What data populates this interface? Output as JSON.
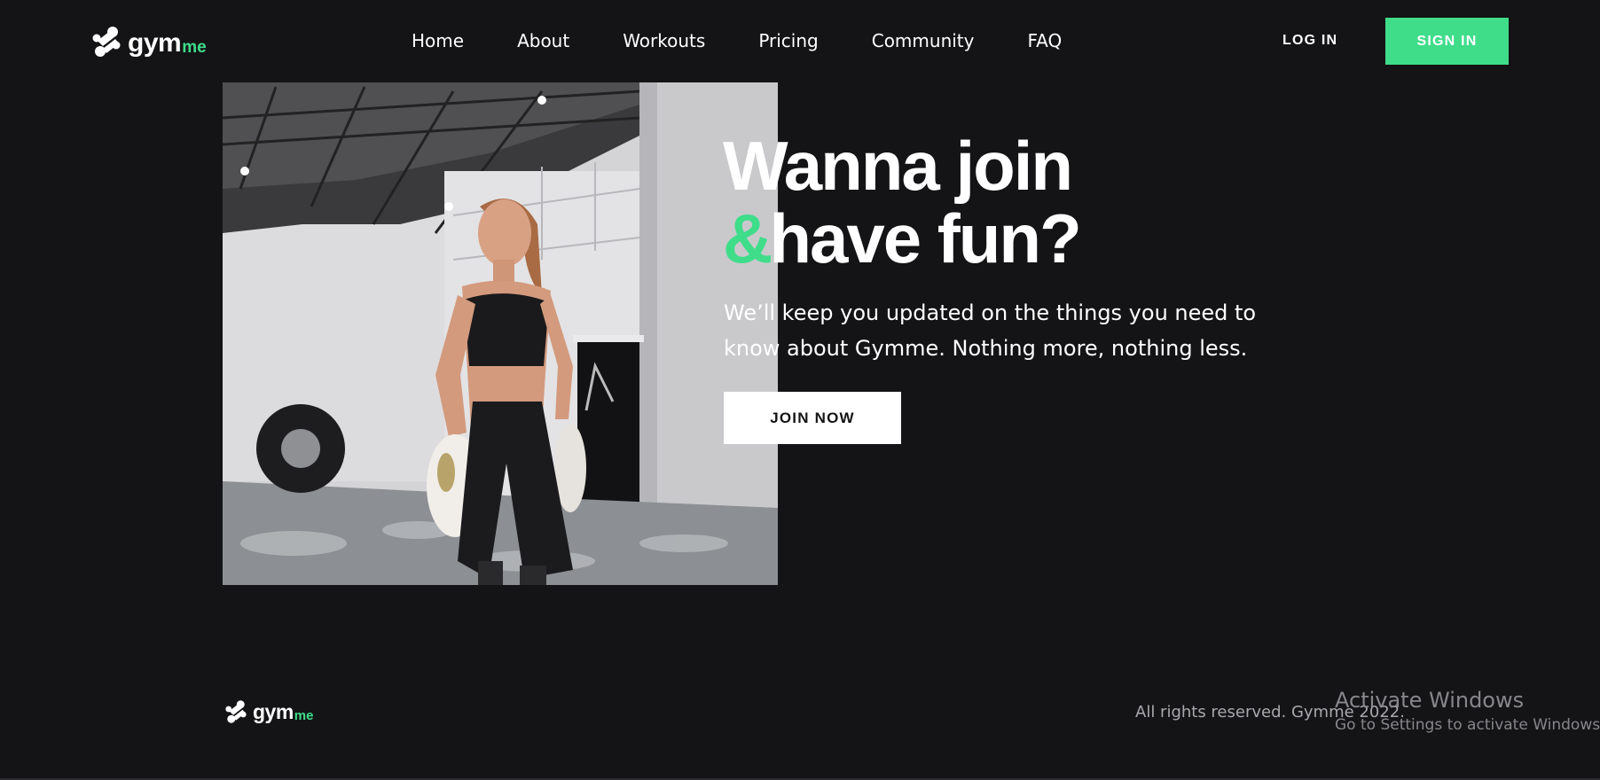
{
  "colors": {
    "background": "#141416",
    "accent": "#3fdd8a",
    "text": "#ffffff",
    "muted": "#a9a9ad"
  },
  "header": {
    "logo": {
      "main": "gym",
      "sub": "me",
      "icon": "gymme-logo-icon"
    },
    "nav": [
      {
        "label": "Home"
      },
      {
        "label": "About"
      },
      {
        "label": "Workouts"
      },
      {
        "label": "Pricing"
      },
      {
        "label": "Community"
      },
      {
        "label": "FAQ"
      }
    ],
    "login_label": "LOG IN",
    "signin_label": "SIGN IN"
  },
  "hero": {
    "title_line1": "Wanna join",
    "title_amp": "&",
    "title_line2": "have fun?",
    "subtitle": "We’ll keep you updated on the things you need to know about Gymme. Nothing more, nothing less.",
    "cta_label": "JOIN NOW",
    "image": "woman-boxer-in-gym-photo"
  },
  "footer": {
    "logo": {
      "main": "gym",
      "sub": "me",
      "icon": "gymme-logo-icon"
    },
    "copyright": "All rights reserved. Gymme 2022."
  },
  "watermark": {
    "title": "Activate Windows",
    "text": "Go to Settings to activate Windows."
  }
}
